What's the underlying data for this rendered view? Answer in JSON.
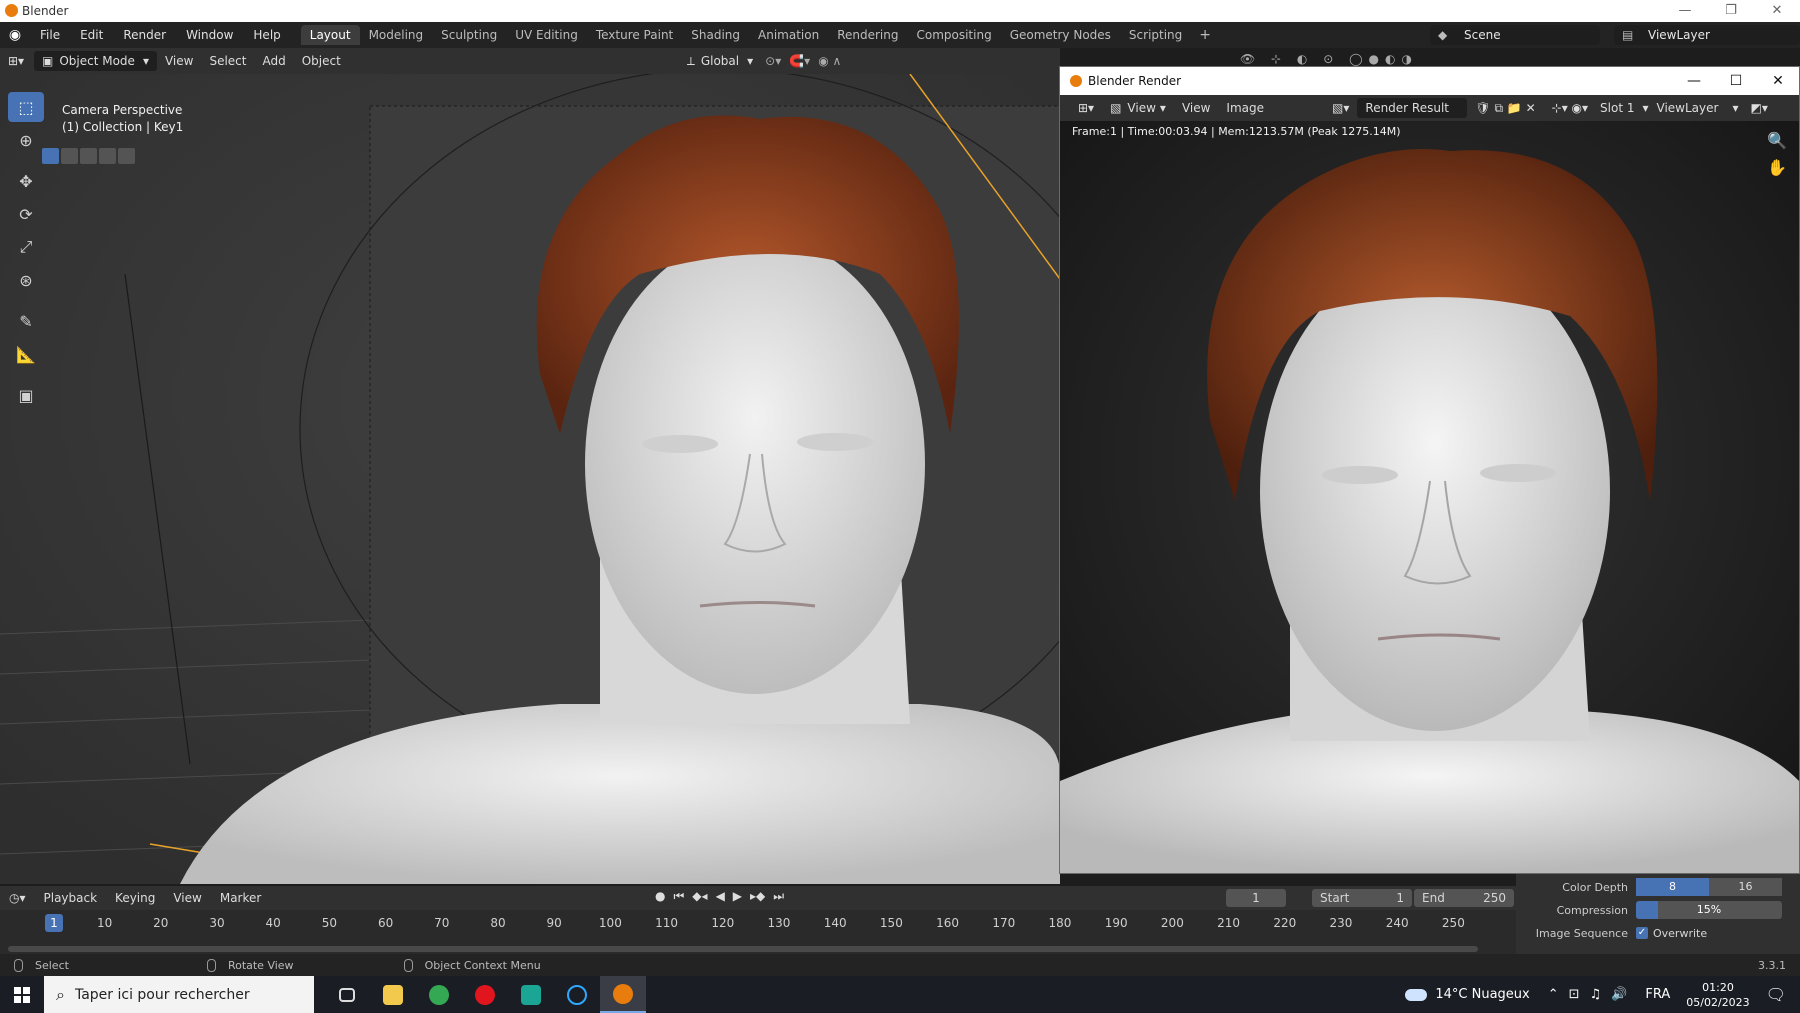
{
  "os": {
    "title": "Blender",
    "controls": [
      "—",
      "❐",
      "✕"
    ]
  },
  "topbar": {
    "menus": [
      "File",
      "Edit",
      "Render",
      "Window",
      "Help"
    ],
    "workspaces": [
      "Layout",
      "Modeling",
      "Sculpting",
      "UV Editing",
      "Texture Paint",
      "Shading",
      "Animation",
      "Rendering",
      "Compositing",
      "Geometry Nodes",
      "Scripting"
    ],
    "active_workspace": "Layout",
    "scene": "Scene",
    "view_layer": "ViewLayer"
  },
  "viewport_header": {
    "mode": "Object Mode",
    "menus": [
      "View",
      "Select",
      "Add",
      "Object"
    ],
    "transform_orientation": "Global"
  },
  "viewport": {
    "camera_label": "Camera Perspective",
    "collection_label": "(1) Collection | Key1",
    "tools": [
      "select-box",
      "cursor",
      "move",
      "rotate",
      "scale",
      "transform",
      "annotate",
      "measure",
      "add-cube"
    ]
  },
  "render_window": {
    "title": "Blender Render",
    "menus": [
      "View",
      "View",
      "Image"
    ],
    "image_name": "Render Result",
    "slot": "Slot 1",
    "view_layer": "ViewLayer",
    "stats": "Frame:1 | Time:00:03.94 | Mem:1213.57M (Peak 1275.14M)"
  },
  "properties": {
    "color_depth_label": "Color Depth",
    "color_depth_options": [
      "8",
      "16"
    ],
    "color_depth_selected": "8",
    "compression_label": "Compression",
    "compression_value": "15%",
    "compression_fraction": 0.15,
    "image_sequence_label": "Image Sequence",
    "overwrite_label": "Overwrite"
  },
  "timeline": {
    "menus": [
      "Playback",
      "Keying",
      "View",
      "Marker"
    ],
    "current_frame": "1",
    "start_label": "Start",
    "start_value": "1",
    "end_label": "End",
    "end_value": "250",
    "ticks": [
      "10",
      "20",
      "30",
      "40",
      "50",
      "60",
      "70",
      "80",
      "90",
      "100",
      "110",
      "120",
      "130",
      "140",
      "150",
      "160",
      "170",
      "180",
      "190",
      "200",
      "210",
      "220",
      "230",
      "240",
      "250"
    ],
    "current_marker": "1"
  },
  "statusbar": {
    "hint_select": "Select",
    "hint_rotate": "Rotate View",
    "hint_context": "Object Context Menu",
    "version": "3.3.1"
  },
  "taskbar": {
    "search_placeholder": "Taper ici pour rechercher",
    "weather": "14°C  Nuageux",
    "language": "FRA",
    "time": "01:20",
    "date": "05/02/2023"
  },
  "colors": {
    "accent": "#4772b3",
    "hair": "#8a3c1c",
    "skin": "#e6e6e6"
  }
}
